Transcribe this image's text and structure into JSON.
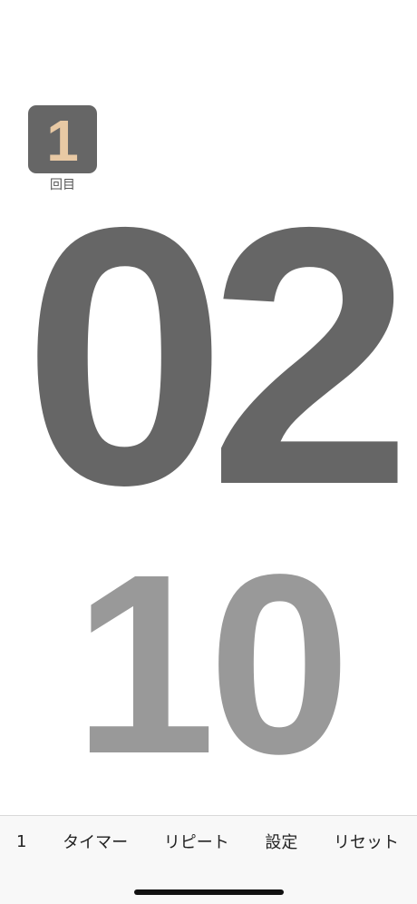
{
  "round": {
    "number": "1",
    "label": "回目"
  },
  "timer": {
    "minutes": "02",
    "seconds": "10"
  },
  "toolbar": {
    "round_count": "1",
    "timer_label": "タイマー",
    "repeat_label": "リピート",
    "settings_label": "設定",
    "reset_label": "リセット"
  },
  "colors": {
    "badge_background": "#666666",
    "badge_number": "#e8c9a4",
    "minutes_text": "#666666",
    "seconds_text": "#999999",
    "toolbar_background": "#f8f8f8"
  }
}
